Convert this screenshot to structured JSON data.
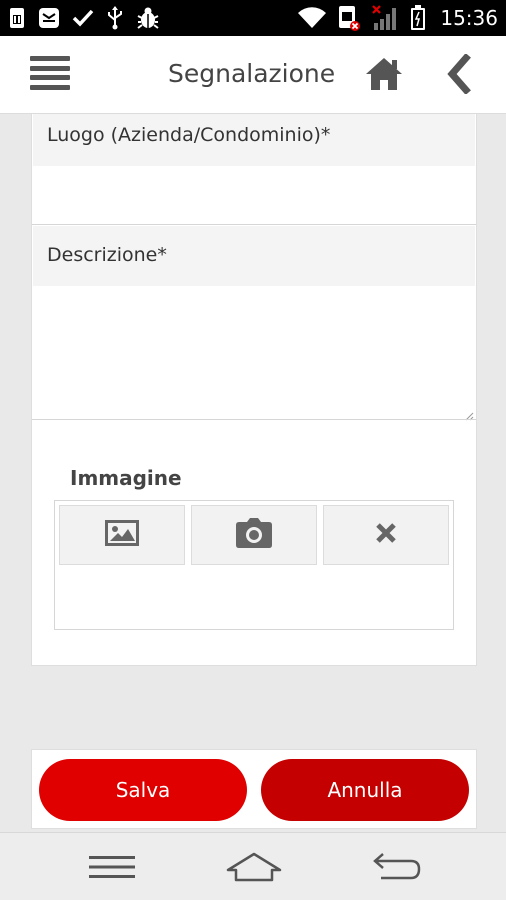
{
  "status_bar": {
    "time": "15:36",
    "icons": [
      "sim-icon",
      "message-icon",
      "check-icon",
      "usb-icon",
      "bug-icon",
      "wifi-icon",
      "sim-no-service-icon",
      "signal-icon",
      "battery-icon"
    ]
  },
  "header": {
    "title": "Segnalazione",
    "menu_icon": "hamburger-menu-icon",
    "home_icon": "home-icon",
    "back_icon": "chevron-left-icon"
  },
  "form": {
    "luogo_label": "Luogo (Azienda/Condominio)*",
    "luogo_value": "",
    "descrizione_label": "Descrizione*",
    "descrizione_value": "",
    "immagine_title": "Immagine",
    "image_buttons": [
      "image-gallery-icon",
      "camera-icon",
      "remove-icon"
    ]
  },
  "actions": {
    "save_label": "Salva",
    "cancel_label": "Annulla"
  },
  "colors": {
    "save": "#e00000",
    "cancel": "#c50000",
    "background": "#e9e9e9",
    "statusbar": "#000000"
  },
  "nav_bar": {
    "icons": [
      "recent-apps-menu-icon",
      "home-icon",
      "back-arrow-icon"
    ]
  }
}
